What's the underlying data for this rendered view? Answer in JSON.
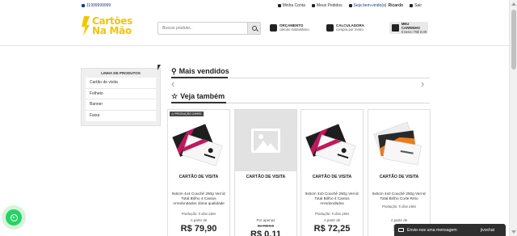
{
  "topbar": {
    "phone": "11999999999",
    "links": [
      {
        "icon": "user-icon",
        "label": "Minha Conta"
      },
      {
        "icon": "checkbox-icon",
        "label": "Meus Pedidos"
      }
    ],
    "welcome_prefix": "Seja bem-vindo(a)",
    "welcome_name": "Ricardo",
    "logout": "Sair"
  },
  "header": {
    "logo_line1": "Cartões",
    "logo_line2": "Na Mão",
    "search_placeholder": "Buscar produto...",
    "orcamento_title": "ORÇAMENTO",
    "orcamento_sub": "cálculo instantâneo",
    "calculadora_title": "CALCULADORA",
    "calculadora_sub": "compra por metro",
    "cart_title": "MEU CARRINHO",
    "cart_sub": "0 itens / R$ 0,00"
  },
  "sidebar": {
    "title": "LINHA DE PRODUTOS",
    "items": [
      {
        "label": "Cartão de visita"
      },
      {
        "label": "Folheto"
      },
      {
        "label": "Banner"
      },
      {
        "label": "Faixa"
      }
    ]
  },
  "sections": {
    "best_sellers": "Mais vendidos",
    "see_also": "Veja também"
  },
  "products": [
    {
      "badge": "PRODUÇÃO 24HRS",
      "name": "CARTÃO DE VISITA",
      "desc": "9x5cm 4x4 Couchê 250g Verniz Total Brilho 4 Cantos Arredondados ótima qualidade",
      "production": "Produção: 5 dias úteis",
      "price_prefix": "A partir de",
      "price": "R$ 79,90",
      "old_price": ""
    },
    {
      "badge": "",
      "name": "CARTÃO DE VISITA",
      "desc": "",
      "production": "",
      "price_prefix": "Por apenas",
      "price": "R$ 0,11",
      "old_price": "De R$ 0,0"
    },
    {
      "badge": "",
      "name": "CARTÃO DE VISITA",
      "desc": "9x5cm 4x0 Couchê 250g Verniz Total Brilho 4 Cantos Arredondados",
      "production": "Produção: 5 dias úteis",
      "price_prefix": "A partir de",
      "price": "R$ 72,25",
      "old_price": ""
    },
    {
      "badge": "",
      "name": "CARTÃO DE VISITA",
      "desc": "9x5cm 4x0 Couchê 250g Verniz Total Brilho Corte Reto",
      "production": "Produção: 5 dias úteis",
      "price_prefix": "A partir de",
      "price": "R$ ",
      "old_price": ""
    }
  ],
  "chat": {
    "label": "Envie-nos uma mensagem",
    "brand": "jivochat"
  },
  "colors": {
    "brand_yellow": "#f5c400",
    "whatsapp_green": "#25d366"
  }
}
